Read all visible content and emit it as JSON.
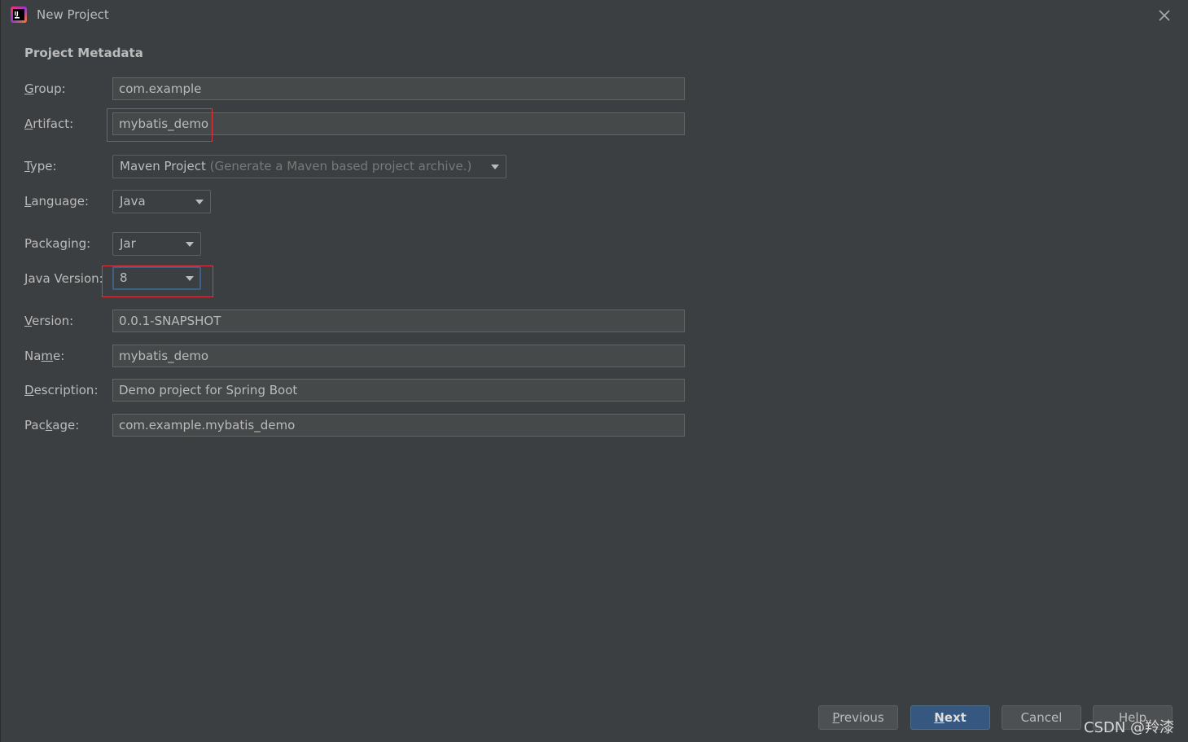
{
  "window": {
    "title": "New Project",
    "icon": "intellij-idea-icon"
  },
  "section_title": "Project Metadata",
  "fields": {
    "group": {
      "label": "Group:",
      "mnemonic": "G",
      "rest": "roup:",
      "value": "com.example"
    },
    "artifact": {
      "label": "Artifact:",
      "mnemonic": "A",
      "rest": "rtifact:",
      "value": "mybatis_demo"
    },
    "type": {
      "label": "Type:",
      "mnemonic": "T",
      "rest": "ype:",
      "value": "Maven Project",
      "hint": "(Generate a Maven based project archive.)"
    },
    "language": {
      "label": "Language:",
      "mnemonic": "L",
      "rest": "anguage:",
      "value": "Java"
    },
    "packaging": {
      "label": "Packaging:",
      "pre": "Packa",
      "mnemonic": "g",
      "rest": "ing:",
      "value": "Jar"
    },
    "java_version": {
      "label": "Java Version:",
      "mnemonic": "J",
      "rest": "ava Version:",
      "value": "8"
    },
    "version": {
      "label": "Version:",
      "mnemonic": "V",
      "rest": "ersion:",
      "value": "0.0.1-SNAPSHOT"
    },
    "name": {
      "label": "Name:",
      "pre": "Na",
      "mnemonic": "m",
      "rest": "e:",
      "value": "mybatis_demo"
    },
    "description": {
      "label": "Description:",
      "mnemonic": "D",
      "rest": "escription:",
      "value": "Demo project for Spring Boot"
    },
    "package": {
      "label": "Package:",
      "pre": "Pac",
      "mnemonic": "k",
      "rest": "age:",
      "value": "com.example.mybatis_demo"
    }
  },
  "buttons": {
    "previous": {
      "mnemonic": "P",
      "rest": "revious"
    },
    "next": {
      "mnemonic": "N",
      "rest": "ext"
    },
    "cancel": "Cancel",
    "help": "Help"
  },
  "watermark": "CSDN @羚漆",
  "colors": {
    "background": "#3c3f41",
    "field_bg": "#45494a",
    "primary_button": "#365880",
    "highlight_box": "#e0353d"
  }
}
